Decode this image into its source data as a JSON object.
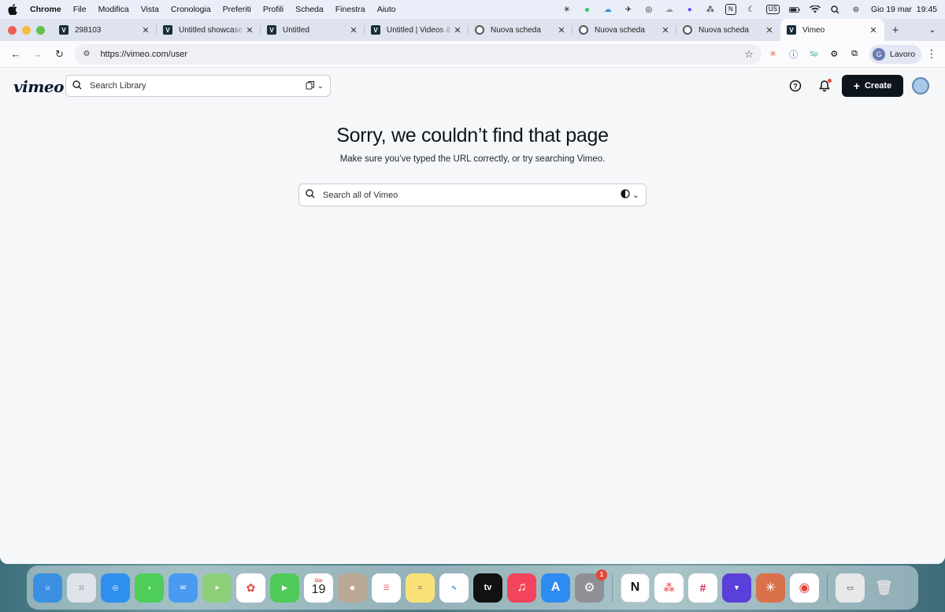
{
  "menubar": {
    "app_name": "Chrome",
    "items": [
      "File",
      "Modifica",
      "Vista",
      "Cronologia",
      "Preferiti",
      "Profili",
      "Scheda",
      "Finestra",
      "Aiuto"
    ],
    "input_source": "US",
    "datetime": "Gio 19 mar  19:45"
  },
  "browser": {
    "tabs": [
      {
        "label": "298103",
        "favicon": "vimeo-icon"
      },
      {
        "label": "Untitled showcase on",
        "favicon": "vimeo-icon"
      },
      {
        "label": "Untitled",
        "favicon": "vimeo-icon"
      },
      {
        "label": "Untitled | Videos & M",
        "favicon": "vimeo-icon"
      },
      {
        "label": "Nuova scheda",
        "favicon": "chrome-icon"
      },
      {
        "label": "Nuova scheda",
        "favicon": "chrome-icon"
      },
      {
        "label": "Nuova scheda",
        "favicon": "chrome-icon"
      },
      {
        "label": "Vimeo",
        "favicon": "vimeo-icon",
        "active": true
      }
    ],
    "url": "https://vimeo.com/user",
    "profile_initial": "G",
    "profile_name": "Lavoro"
  },
  "vimeo": {
    "logo": "vimeo",
    "library_search_placeholder": "Search Library",
    "create_label": "Create",
    "error_title": "Sorry, we couldn’t find that page",
    "error_subtitle": "Make sure you’ve typed the URL correctly, or try searching Vimeo.",
    "global_search_placeholder": "Search all of Vimeo"
  },
  "dock": {
    "calendar_month": "Gio",
    "calendar_day": "19",
    "settings_badge": "1",
    "tv_label": "tv"
  },
  "colors": {
    "accent": "#0e141b",
    "page_bg": "#f6f7f9",
    "notification_dot": "#e64a3b"
  }
}
